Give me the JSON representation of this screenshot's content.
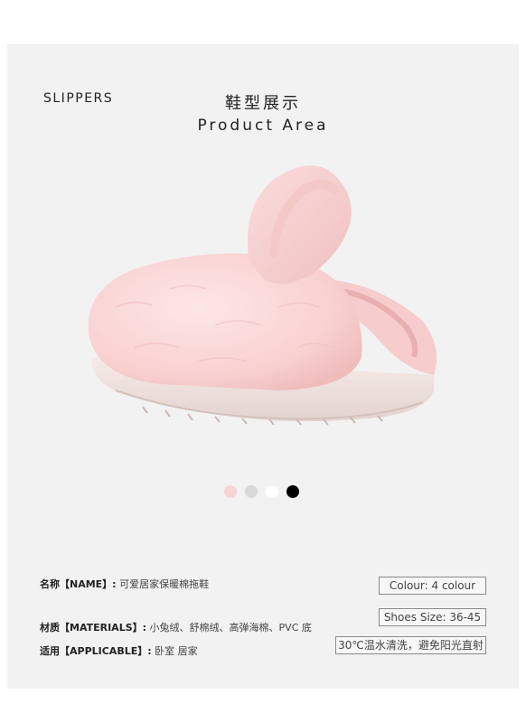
{
  "header": {
    "slippers": "SLIPPERS",
    "title_cn": "鞋型展示",
    "title_en": "Product Area"
  },
  "product": {
    "icon": "bunny-ear-slipper-image",
    "colors": [
      "#f7d3d3",
      "#d9d9d9",
      "#ffffff",
      "#000000"
    ]
  },
  "specs": {
    "name_label": "名称【NAME】:",
    "name_value": "可爱居家保暖棉拖鞋",
    "materials_label": "材质【MATERIALS】:",
    "materials_value": "小兔绒、舒棉绒、高弹海棉、PVC 底",
    "applicable_label": "适用【APPLICABLE】:",
    "applicable_value": "卧室  居家"
  },
  "boxes": {
    "colour": "Colour:  4 colour",
    "size": "Shoes Size:  36-45",
    "care": "30℃温水清洗，避免阳光直射"
  }
}
